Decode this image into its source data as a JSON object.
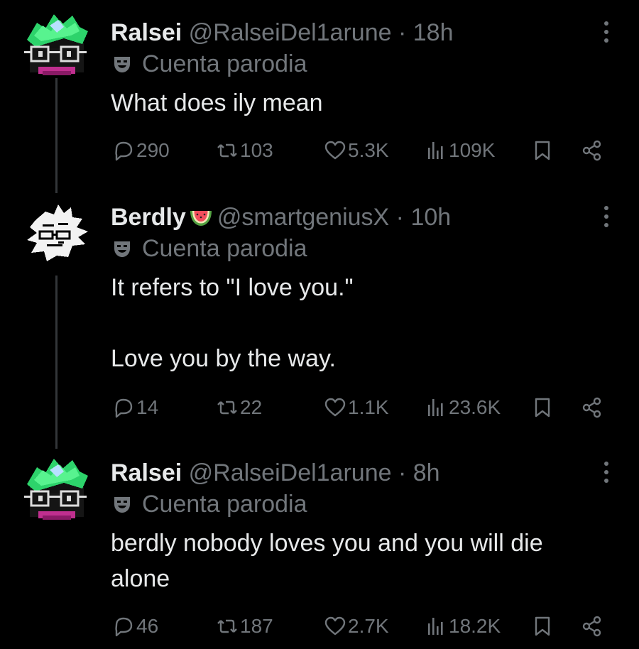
{
  "colors": {
    "background": "#000000",
    "text": "#e7e9ea",
    "muted": "#71767b",
    "thread_line": "#333639"
  },
  "tweets": [
    {
      "name": "Ralsei",
      "handle": "@RalseiDel1arune",
      "time": "· 18h",
      "badge": "Cuenta parodia",
      "lines": [
        "What does ily mean"
      ],
      "replies": "290",
      "reposts": "103",
      "likes": "5.3K",
      "views": "109K",
      "avatar": "ralsei-avatar"
    },
    {
      "name": "Berdly",
      "emoji": "watermelon-icon",
      "handle": "@smartgeniusX",
      "time": "· 10h",
      "badge": "Cuenta parodia",
      "lines": [
        "It refers to \"I love you.\"",
        "",
        "Love you by the way."
      ],
      "replies": "14",
      "reposts": "22",
      "likes": "1.1K",
      "views": "23.6K",
      "avatar": "berdly-avatar"
    },
    {
      "name": "Ralsei",
      "handle": "@RalseiDel1arune",
      "time": "· 8h",
      "badge": "Cuenta parodia",
      "lines": [
        "berdly nobody loves you and you will die",
        "alone"
      ],
      "replies": "46",
      "reposts": "187",
      "likes": "2.7K",
      "views": "18.2K",
      "avatar": "ralsei-avatar"
    }
  ]
}
